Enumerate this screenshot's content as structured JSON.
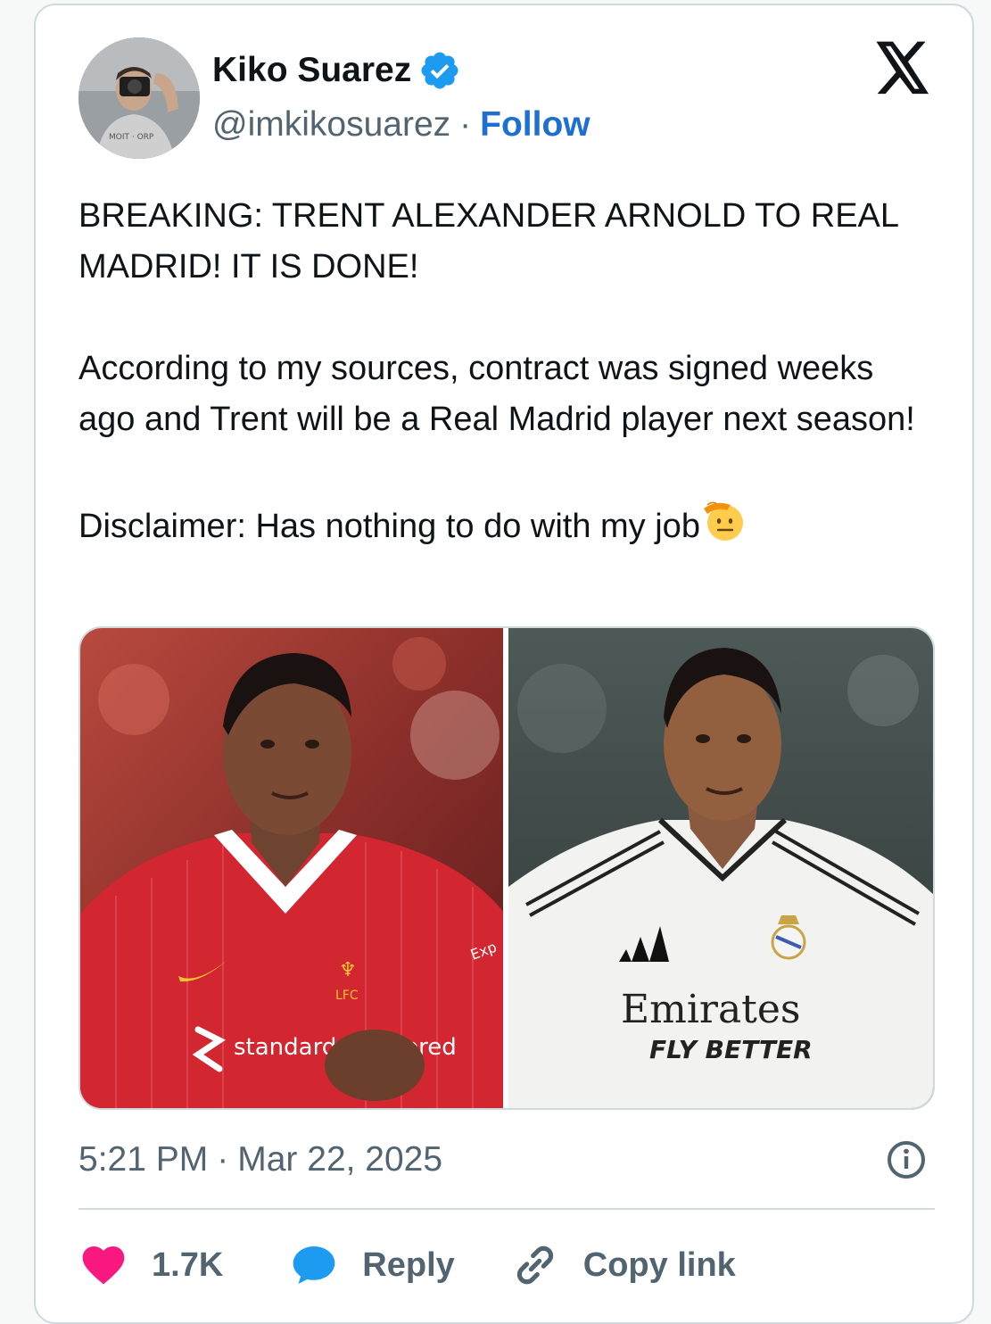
{
  "colors": {
    "verified": "#1d9bf0",
    "follow": "#1d6fd1",
    "like": "#f91880",
    "reply_icon": "#1d9bf0",
    "secondary_text": "#536471",
    "primary_text": "#0f1419"
  },
  "author": {
    "name": "Kiko Suarez",
    "handle": "@imkikosuarez",
    "separator": "·",
    "follow_label": "Follow",
    "verified_icon": "verified-badge-icon"
  },
  "tweet": {
    "paragraphs": [
      "BREAKING: TRENT ALEXANDER ARNOLD TO REAL MADRID! IT IS DONE!",
      "According to my sources, contract was signed weeks ago and Trent will be a Real Madrid player next season!",
      "Disclaimer: Has nothing to do with my job"
    ],
    "emoji": "saluting-face-icon"
  },
  "media": {
    "left_photo": {
      "kit_sponsor": "standard chartered",
      "crest": "LFC",
      "sleeve": "Exp"
    },
    "right_photo": {
      "sponsor_line1": "Emirates",
      "sponsor_line2": "FLY BETTER"
    }
  },
  "meta": {
    "time": "5:21 PM",
    "separator": "·",
    "date": "Mar 22, 2025"
  },
  "actions": {
    "likes": "1.7K",
    "reply_label": "Reply",
    "copy_label": "Copy link"
  }
}
